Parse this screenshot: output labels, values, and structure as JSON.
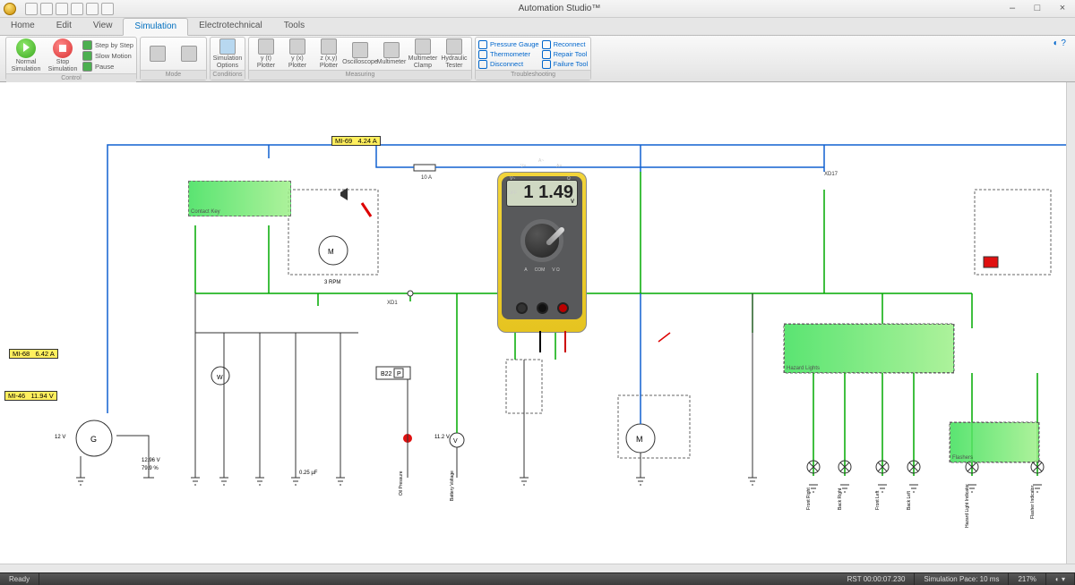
{
  "title": "Automation Studio™",
  "tabs": [
    "Home",
    "Edit",
    "View",
    "Simulation",
    "Electrotechnical",
    "Tools"
  ],
  "active_tab": 3,
  "ribbon": {
    "control": {
      "label": "Control",
      "normal_sim": "Normal\nSimulation",
      "stop_sim": "Stop\nSimulation",
      "step": "Step by Step",
      "slow": "Slow Motion",
      "pause": "Pause"
    },
    "mode": {
      "label": "Mode"
    },
    "conditions": {
      "label": "Conditions",
      "sim_opt": "Simulation\nOptions"
    },
    "measuring": {
      "label": "Measuring",
      "y_t": "y (t)\nPlotter",
      "y_x": "y (x)\nPlotter",
      "z_xy": "z (x,y)\nPlotter",
      "osc": "Oscilloscope",
      "multi": "Multimeter",
      "clamp": "Multimeter\nClamp",
      "hyd": "Hydraulic\nTester"
    },
    "troubleshooting": {
      "label": "Troubleshooting",
      "pressure": "Pressure Gauge",
      "thermo": "Thermometer",
      "disc": "Disconnect",
      "reconnect": "Reconnect",
      "repair": "Repair Tool",
      "failure": "Failure Tool"
    }
  },
  "measurements": {
    "mi69": {
      "id": "MI-69",
      "val": "4.24 A"
    },
    "mi68": {
      "id": "MI-68",
      "val": "6.42 A"
    },
    "mi46": {
      "id": "MI-46",
      "val": "11.94 V"
    }
  },
  "multimeter": {
    "reading": "1 1.49",
    "unit": "V",
    "labels": {
      "off": "OFF",
      "vdc": "V=",
      "vac": "V~",
      "aac": "A~",
      "adc": "A=",
      "ohm": "Ω",
      "a": "A",
      "com": "COM",
      "vohm": "V Ω"
    }
  },
  "schematic": {
    "contact_key": "Contact Key",
    "hazard": "Hazard Lights",
    "flashers": "Flashers",
    "b22": "B22",
    "p": "P",
    "xd1": "XD1",
    "xd17": "XD17",
    "m": "M",
    "g": "G",
    "w": "W",
    "fuse": "10 A",
    "rpm": "3 RPM",
    "voltage_12": "12 V",
    "voltage_1296": "12.96 V",
    "pct": "79.9 %",
    "cap": "0.25 µF",
    "v112": "11.2 V",
    "lamp_labels": [
      "Front Right",
      "Back Right",
      "Front Left",
      "Back Left",
      "Hazard Light Indicator",
      "Flasher Indicator"
    ],
    "oil": "Oil Pressure",
    "batt": "Battery Voltage"
  },
  "statusbar": {
    "ready": "Ready",
    "rst": "RST 00:00:07.230",
    "pace": "Simulation Pace: 10 ms",
    "zoom": "217%"
  }
}
